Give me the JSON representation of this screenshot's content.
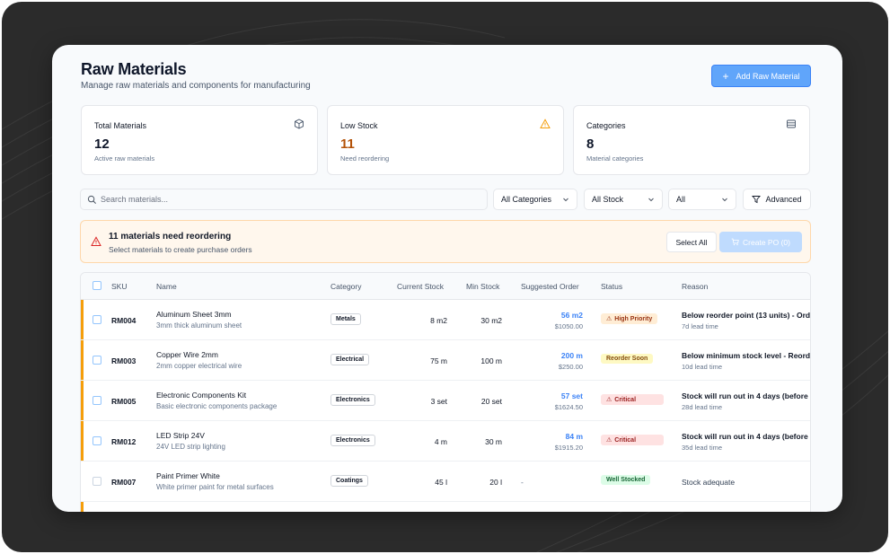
{
  "header": {
    "title": "Raw Materials",
    "subtitle": "Manage raw materials and components for manufacturing",
    "add_button": "Add Raw Material"
  },
  "stats": [
    {
      "label": "Total Materials",
      "value": "12",
      "sub": "Active raw materials",
      "icon": "box-icon"
    },
    {
      "label": "Low Stock",
      "value": "11",
      "sub": "Need reordering",
      "icon": "warning-icon"
    },
    {
      "label": "Categories",
      "value": "8",
      "sub": "Material categories",
      "icon": "database-icon"
    }
  ],
  "filters": {
    "search_placeholder": "Search materials...",
    "category": "All Categories",
    "stock": "All Stock",
    "all": "All",
    "advanced": "Advanced"
  },
  "alert": {
    "title": "11 materials need reordering",
    "subtitle": "Select materials to create purchase orders",
    "select_all": "Select All",
    "create_po": "Create PO (0)"
  },
  "table": {
    "columns": [
      "SKU",
      "Name",
      "Category",
      "Current Stock",
      "Min Stock",
      "Suggested Order",
      "Status",
      "Reason"
    ],
    "rows": [
      {
        "sku": "RM004",
        "name": "Aluminum Sheet 3mm",
        "desc": "3mm thick aluminum sheet",
        "category": "Metals",
        "current": "8 m2",
        "min": "30 m2",
        "suggested": "56 m2",
        "price": "$1050.00",
        "status": "High Priority",
        "reason": "Below reorder point (13 units) - Ord",
        "lead": "7d lead time"
      },
      {
        "sku": "RM003",
        "name": "Copper Wire 2mm",
        "desc": "2mm copper electrical wire",
        "category": "Electrical",
        "current": "75 m",
        "min": "100 m",
        "suggested": "200 m",
        "price": "$250.00",
        "status": "Reorder Soon",
        "reason": "Below minimum stock level - Reord",
        "lead": "10d lead time"
      },
      {
        "sku": "RM005",
        "name": "Electronic Components Kit",
        "desc": "Basic electronic components package",
        "category": "Electronics",
        "current": "3 set",
        "min": "20 set",
        "suggested": "57 set",
        "price": "$1624.50",
        "status": "Critical",
        "reason": "Stock will run out in 4 days (before",
        "lead": "28d lead time"
      },
      {
        "sku": "RM012",
        "name": "LED Strip 24V",
        "desc": "24V LED strip lighting",
        "category": "Electronics",
        "current": "4 m",
        "min": "30 m",
        "suggested": "84 m",
        "price": "$1915.20",
        "status": "Critical",
        "reason": "Stock will run out in 4 days (before",
        "lead": "35d lead time"
      },
      {
        "sku": "RM007",
        "name": "Paint Primer White",
        "desc": "White primer paint for metal surfaces",
        "category": "Coatings",
        "current": "45 l",
        "min": "20 l",
        "suggested": "-",
        "price": "",
        "status": "Well Stocked",
        "reason": "Stock adequate",
        "lead": ""
      }
    ]
  },
  "colors": {
    "accent": "#60a5fa",
    "warning": "#f59e0b",
    "low_stock_value": "#b45309",
    "frame": "#2b2b2b"
  }
}
